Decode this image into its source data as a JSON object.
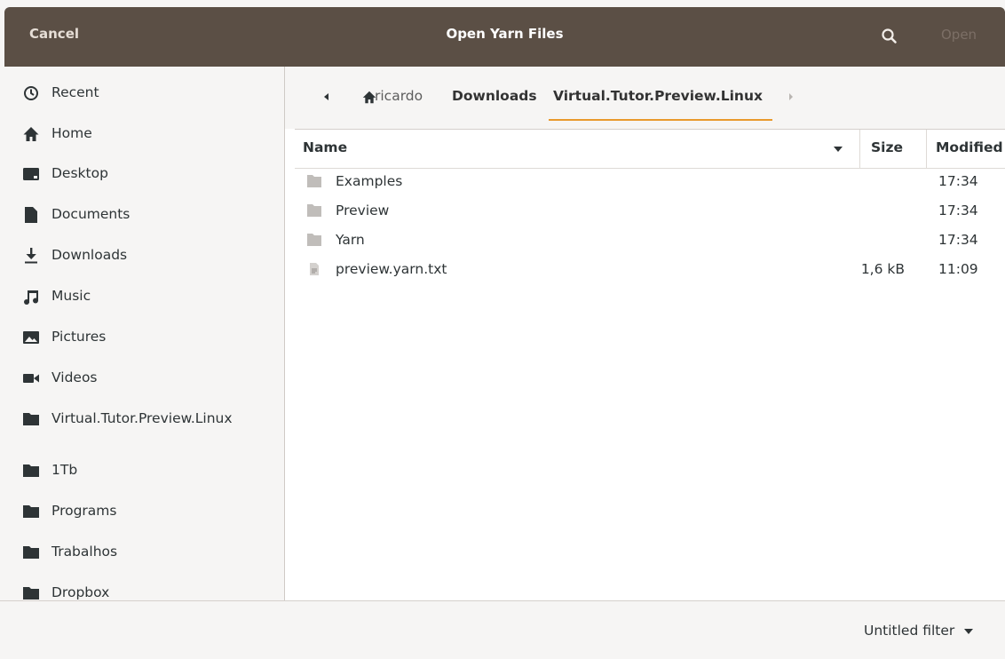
{
  "header": {
    "cancel_label": "Cancel",
    "title": "Open Yarn Files",
    "open_label": "Open",
    "search_icon": "search-icon"
  },
  "sidebar": {
    "items": [
      {
        "label": "Recent",
        "icon": "clock-icon"
      },
      {
        "label": "Home",
        "icon": "home-icon"
      },
      {
        "label": "Desktop",
        "icon": "desktop-icon"
      },
      {
        "label": "Documents",
        "icon": "document-icon"
      },
      {
        "label": "Downloads",
        "icon": "download-icon"
      },
      {
        "label": "Music",
        "icon": "music-icon"
      },
      {
        "label": "Pictures",
        "icon": "pictures-icon"
      },
      {
        "label": "Videos",
        "icon": "video-icon"
      },
      {
        "label": "Virtual.Tutor.Preview.Linux",
        "icon": "folder-icon"
      },
      {
        "label": "1Tb",
        "icon": "folder-icon"
      },
      {
        "label": "Programs",
        "icon": "folder-icon"
      },
      {
        "label": "Trabalhos",
        "icon": "folder-icon"
      },
      {
        "label": "Dropbox",
        "icon": "folder-icon"
      }
    ]
  },
  "pathbar": {
    "home": "ricardo",
    "downloads": "Downloads",
    "current": "Virtual.Tutor.Preview.Linux"
  },
  "columns": {
    "name": "Name",
    "size": "Size",
    "modified": "Modified"
  },
  "files": [
    {
      "name": "Examples",
      "size": "",
      "modified": "17:34",
      "type": "folder"
    },
    {
      "name": "Preview",
      "size": "",
      "modified": "17:34",
      "type": "folder"
    },
    {
      "name": "Yarn",
      "size": "",
      "modified": "17:34",
      "type": "folder"
    },
    {
      "name": "preview.yarn.txt",
      "size": "1,6 kB",
      "modified": "11:09",
      "type": "text-file"
    }
  ],
  "filter": {
    "label": "Untitled filter"
  },
  "colors": {
    "headerbar": "#5b4f45",
    "accent": "#e99a2d"
  }
}
